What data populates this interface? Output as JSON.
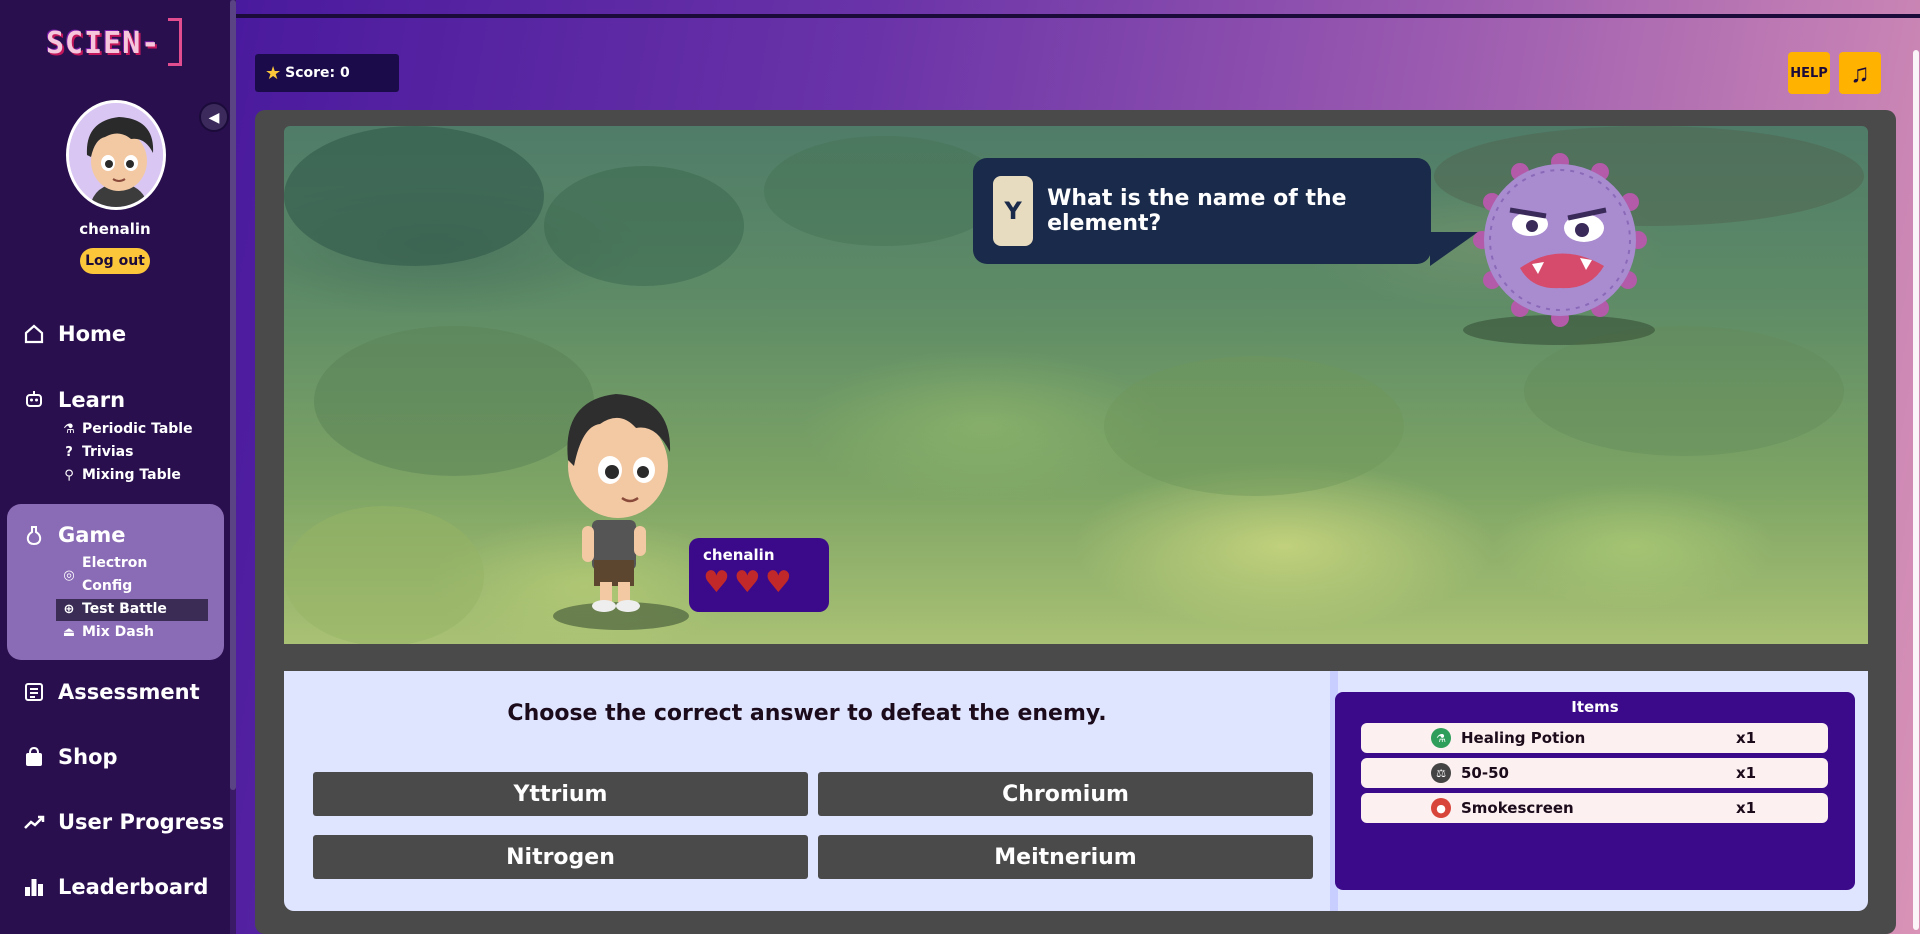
{
  "app": {
    "logo_text": "SCIEN-"
  },
  "sidebar": {
    "username": "chenalin",
    "logout_label": "Log out",
    "nav": {
      "home": "Home",
      "learn": "Learn",
      "learn_items": [
        "Periodic Table",
        "Trivias",
        "Mixing Table"
      ],
      "game": "Game",
      "game_items": [
        "Electron Config",
        "Test Battle",
        "Mix Dash"
      ],
      "assessment": "Assessment",
      "shop": "Shop",
      "user_progress": "User Progress",
      "leaderboard": "Leaderboard"
    },
    "active_item": "Test Battle"
  },
  "header": {
    "score_label": "Score: 0",
    "help_label": "HELP",
    "music_icon": "music-note-icon"
  },
  "battle": {
    "element_symbol": "Y",
    "question": "What is the name of the element?",
    "player_name": "chenalin",
    "player_hearts": 3
  },
  "answers": {
    "prompt": "Choose the correct answer to defeat the enemy.",
    "options": [
      "Yttrium",
      "Chromium",
      "Nitrogen",
      "Meitnerium"
    ]
  },
  "items": {
    "title": "Items",
    "list": [
      {
        "name": "Healing Potion",
        "qty": "x1",
        "icon": "potion-icon",
        "color": "#2e9e5a"
      },
      {
        "name": "50-50",
        "qty": "x1",
        "icon": "scale-icon",
        "color": "#444444"
      },
      {
        "name": "Smokescreen",
        "qty": "x1",
        "icon": "smoke-bomb-icon",
        "color": "#d8453b"
      }
    ]
  },
  "colors": {
    "sidebar": "#2a0f4f",
    "accent": "#fcc63b",
    "panel_dark": "#3a0a8a",
    "answer_button": "#4a4a4a"
  }
}
